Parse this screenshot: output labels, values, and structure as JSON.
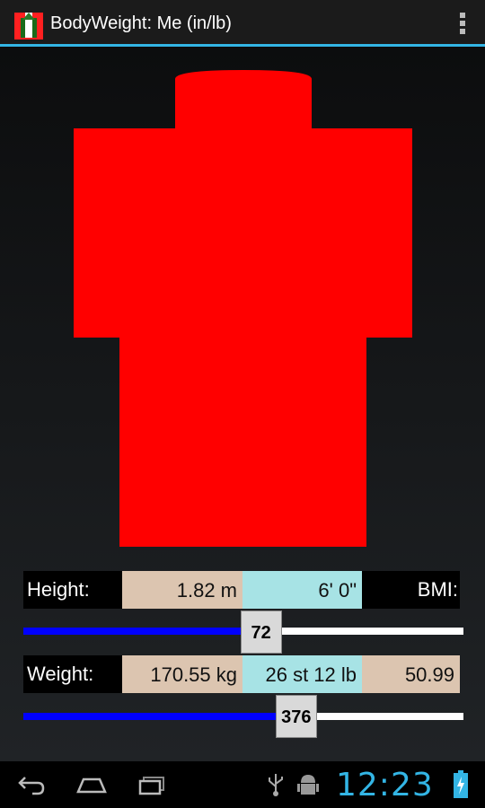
{
  "action_bar": {
    "title": "BodyWeight: Me  (in/lb)",
    "icon": "app-logo-icon",
    "overflow_icon": "overflow-menu-icon"
  },
  "body_figure": {
    "color": "#ff0000"
  },
  "height_row": {
    "label": "Height:",
    "metric": "1.82 m",
    "imperial": "6' 0\"",
    "bmi_label": "BMI:"
  },
  "height_slider": {
    "value": "72",
    "fraction": 0.54
  },
  "weight_row": {
    "label": "Weight:",
    "metric": "170.55 kg",
    "stone": "26 st 12 lb",
    "bmi_value": "50.99"
  },
  "weight_slider": {
    "value": "376",
    "fraction": 0.62
  },
  "colors": {
    "accent": "#33b5e5",
    "tan_cell": "#dcc5b0",
    "cyan_cell": "#a7e3e5",
    "slider_fill": "#0000ff"
  },
  "nav_bar": {
    "back_icon": "back-icon",
    "home_icon": "home-icon",
    "recents_icon": "recent-apps-icon"
  },
  "status_bar": {
    "time": "12:23",
    "usb_icon": "usb-icon",
    "android_icon": "android-debug-icon",
    "battery_icon": "battery-charging-icon"
  }
}
